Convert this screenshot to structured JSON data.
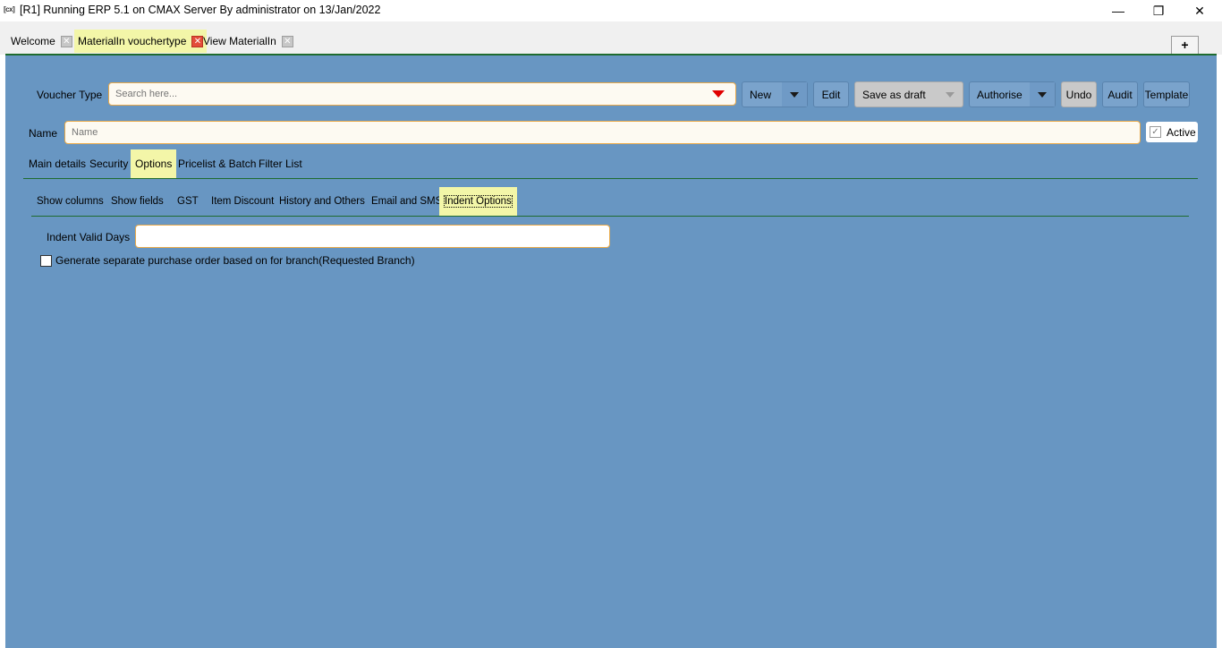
{
  "window": {
    "icon_text": "[cx]",
    "title": "[R1] Running ERP 5.1 on CMAX Server By administrator on 13/Jan/2022",
    "minimize": "—",
    "maximize": "❐",
    "close": "✕"
  },
  "doc_tabs": [
    {
      "label": "Welcome",
      "close": "✕"
    },
    {
      "label": "MaterialIn vouchertype",
      "close": "✕"
    },
    {
      "label": "View MaterialIn",
      "close": "✕"
    }
  ],
  "add_tab": "+",
  "toolbar": {
    "voucher_type_label": "Voucher Type",
    "search_placeholder": "Search here...",
    "new": "New",
    "edit": "Edit",
    "save_as_draft": "Save as draft",
    "authorise": "Authorise",
    "undo": "Undo",
    "audit": "Audit",
    "template": "Template"
  },
  "name_row": {
    "label": "Name",
    "placeholder": "Name",
    "active_label": "Active",
    "active_check": "✓"
  },
  "main_tabs": [
    "Main details",
    "Security",
    "Options",
    "Pricelist & Batch",
    "Filter List"
  ],
  "option_tabs": [
    "Show columns",
    "Show fields",
    "GST",
    "Item Discount",
    "History and Others",
    "Email and SMS",
    "Indent Options"
  ],
  "indent": {
    "valid_days_label": "Indent Valid Days",
    "valid_days_value": "",
    "checkbox_label": "Generate separate purchase order based on for branch(Requested Branch)"
  },
  "colors": {
    "panel": "#6896c2",
    "highlight": "#f3f6a8",
    "accent_line": "#1e6b2f",
    "input_border": "#e8a94a"
  }
}
